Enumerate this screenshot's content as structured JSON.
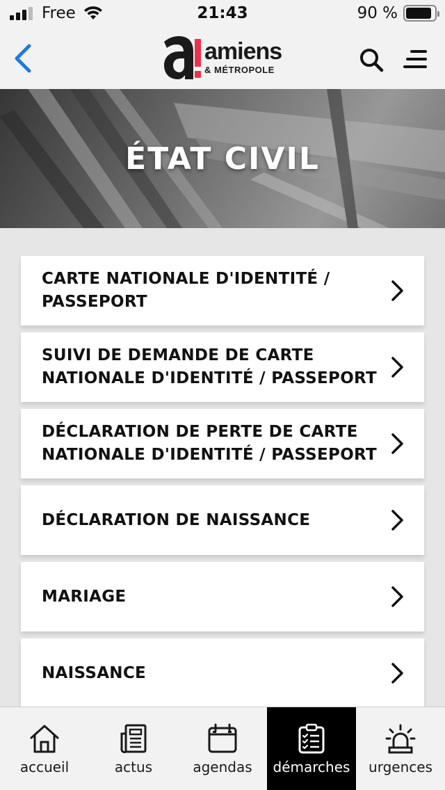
{
  "status": {
    "carrier": "Free",
    "time": "21:43",
    "battery_pct": "90 %",
    "battery_level": 0.9
  },
  "header": {
    "logo_name": "amiens",
    "logo_sub": "& MÉTROPOLE",
    "logo_mark_letter": "a",
    "logo_accent_color": "#e8334a",
    "back_color": "#1f7ae0"
  },
  "hero": {
    "title": "ÉTAT CIVIL"
  },
  "items": [
    {
      "label": "CARTE NATIONALE D'IDENTITÉ / PASSEPORT"
    },
    {
      "label": "SUIVI DE DEMANDE DE CARTE NATIONALE D'IDENTITÉ / PASSEPORT"
    },
    {
      "label": "DÉCLARATION DE PERTE DE CARTE NATIONALE D'IDENTITÉ / PASSEPORT"
    },
    {
      "label": "DÉCLARATION DE NAISSANCE"
    },
    {
      "label": "MARIAGE"
    },
    {
      "label": "NAISSANCE"
    }
  ],
  "tabs": [
    {
      "label": "accueil",
      "icon": "home-icon",
      "active": false
    },
    {
      "label": "actus",
      "icon": "news-icon",
      "active": false
    },
    {
      "label": "agendas",
      "icon": "calendar-icon",
      "active": false
    },
    {
      "label": "démarches",
      "icon": "clipboard-checklist-icon",
      "active": true
    },
    {
      "label": "urgences",
      "icon": "alarm-siren-icon",
      "active": false
    }
  ]
}
